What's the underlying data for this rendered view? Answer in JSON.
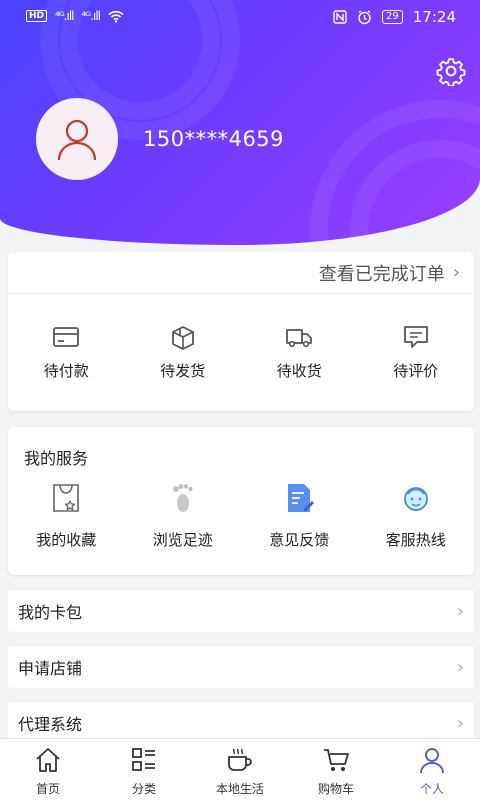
{
  "status_bar": {
    "network_badge": "HD",
    "signal1": "⁴ᴳ.ıll",
    "signal2": "⁴ᴳ.ıll",
    "battery": "29",
    "time": "17:24"
  },
  "profile": {
    "phone": "150****4659"
  },
  "orders": {
    "view_completed": "查看已完成订单",
    "items": [
      {
        "label": "待付款",
        "icon": "card-icon"
      },
      {
        "label": "待发货",
        "icon": "package-icon"
      },
      {
        "label": "待收货",
        "icon": "truck-icon"
      },
      {
        "label": "待评价",
        "icon": "comment-icon"
      }
    ]
  },
  "services": {
    "title": "我的服务",
    "items": [
      {
        "label": "我的收藏",
        "icon": "favorite-bag-icon"
      },
      {
        "label": "浏览足迹",
        "icon": "footprint-icon"
      },
      {
        "label": "意见反馈",
        "icon": "feedback-icon"
      },
      {
        "label": "客服热线",
        "icon": "customer-service-icon"
      }
    ]
  },
  "menu": [
    {
      "label": "我的卡包"
    },
    {
      "label": "申请店铺"
    },
    {
      "label": "代理系统"
    }
  ],
  "tabbar": {
    "items": [
      {
        "label": "首页",
        "icon": "home-icon",
        "active": false
      },
      {
        "label": "分类",
        "icon": "category-icon",
        "active": false
      },
      {
        "label": "本地生活",
        "icon": "coffee-cup-icon",
        "active": false
      },
      {
        "label": "购物车",
        "icon": "cart-icon",
        "active": false
      },
      {
        "label": "个人",
        "icon": "person-icon",
        "active": true
      }
    ]
  },
  "colors": {
    "accent": "#4b5bdc",
    "header_start": "#4a43ff",
    "header_end": "#9a3dff"
  }
}
